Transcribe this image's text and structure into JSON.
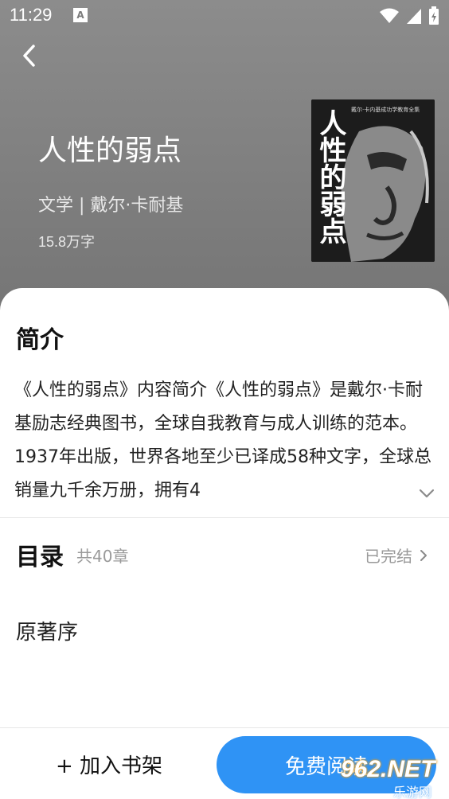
{
  "status_bar": {
    "time": "11:29",
    "indicator": "A",
    "icons": [
      "wifi-icon",
      "signal-icon",
      "battery-icon"
    ]
  },
  "book": {
    "title": "人性的弱点",
    "meta": "文学 | 戴尔·卡耐基",
    "word_count": "15.8万字",
    "cover": {
      "title": "人性的弱点",
      "subtitle": "戴尔·卡内基成功学教育全集"
    }
  },
  "intro": {
    "heading": "简介",
    "text": "《人性的弱点》内容简介《人性的弱点》是戴尔·卡耐基励志经典图书，全球自我教育与成人训练的范本。1937年出版，世界各地至少已译成58种文字，全球总销量九千余万册，拥有4"
  },
  "toc": {
    "heading": "目录",
    "count": "共40章",
    "status": "已完结",
    "first_chapter": "原著序"
  },
  "actions": {
    "add_shelf": "+ 加入书架",
    "read": "免费阅读"
  },
  "watermark": {
    "main": "962.NET",
    "sub": "乐游网"
  },
  "colors": {
    "accent": "#2f93f5",
    "hero_bg": "#808080"
  }
}
